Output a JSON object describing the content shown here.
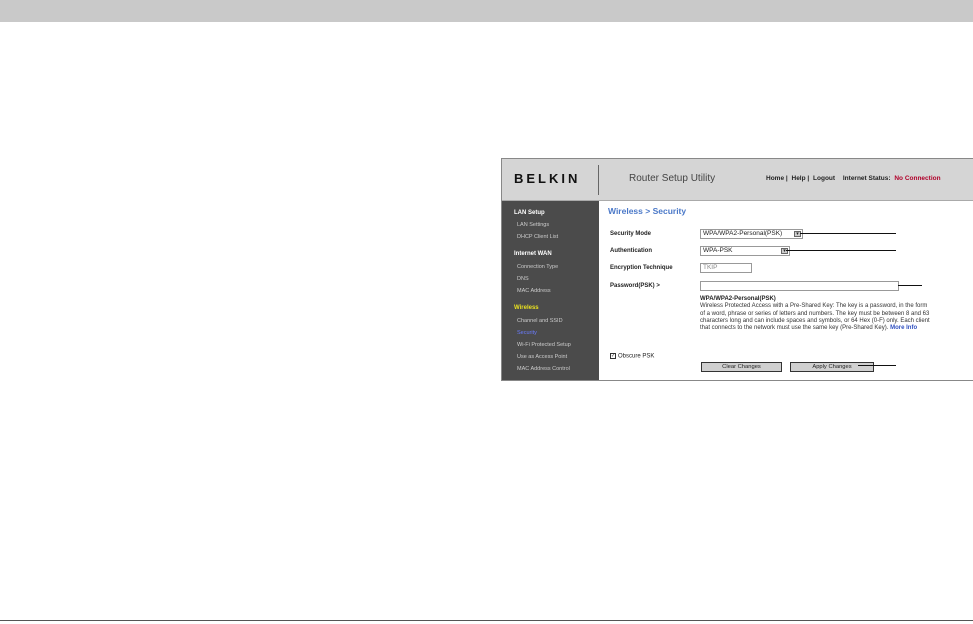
{
  "app": {
    "logo": "BELKIN",
    "title": "Router Setup Utility",
    "nav": [
      "Home |",
      "Help |",
      "Logout"
    ],
    "status_label": "Internet Status:",
    "status_value": "No Connection"
  },
  "sidebar": {
    "sections": [
      {
        "header": "LAN Setup",
        "items": [
          "LAN Settings",
          "DHCP Client List"
        ]
      },
      {
        "header": "Internet WAN",
        "items": [
          "Connection Type",
          "DNS",
          "MAC Address"
        ]
      },
      {
        "header": "Wireless",
        "items": [
          "Channel and SSID",
          "Security",
          "Wi-Fi Protected Setup",
          "Use as Access Point",
          "MAC Address Control"
        ]
      }
    ],
    "active": "Security"
  },
  "main": {
    "breadcrumb": "Wireless > Security",
    "security_mode": {
      "label": "Security Mode",
      "value": "WPA/WPA2-Personal(PSK)"
    },
    "authentication": {
      "label": "Authentication",
      "value": "WPA-PSK"
    },
    "encryption": {
      "label": "Encryption Technique",
      "value": "TKIP"
    },
    "password": {
      "label": "Password(PSK) >",
      "value": ""
    },
    "desc_title": "WPA/WPA2-Personal(PSK)",
    "desc_text": "Wireless Protected Access with a Pre-Shared Key: The key is a password, in the form of a word, phrase or series of letters and numbers. The key must be between 8 and 63 characters long and can include spaces and symbols, or 64 Hex (0-F) only. Each client that connects to the network must use the same key (Pre-Shared Key).",
    "more_info": "More Info",
    "obscure_label": "Obscure PSK",
    "obscure_checked": true,
    "clear_button": "Clear Changes",
    "apply_button": "Apply Changes"
  }
}
